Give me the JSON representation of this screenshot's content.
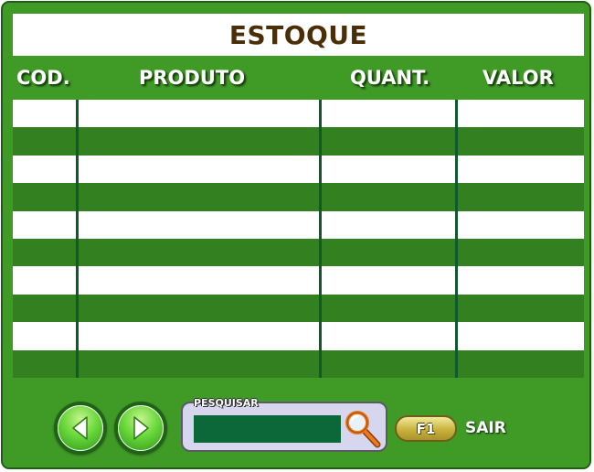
{
  "window": {
    "title": "ESTOQUE"
  },
  "table": {
    "columns": [
      "COD.",
      "PRODUTO",
      "QUANT.",
      "VALOR"
    ],
    "rows": []
  },
  "colors": {
    "panel_green": "#3f9a26",
    "row_dark": "#338021",
    "row_light": "#ffffff",
    "column_divider": "#0f5a2c",
    "title_text": "#4a2e08",
    "search_field": "#0c6838",
    "search_panel": "#d6d6ee",
    "f1_key": "#c8b33c"
  },
  "navigation": {
    "previous_icon": "arrow-left-icon",
    "next_icon": "arrow-right-icon"
  },
  "search": {
    "label": "PESQUISAR",
    "value": "",
    "placeholder": "",
    "icon": "magnifier-icon"
  },
  "exit": {
    "key": "F1",
    "label": "SAIR"
  }
}
